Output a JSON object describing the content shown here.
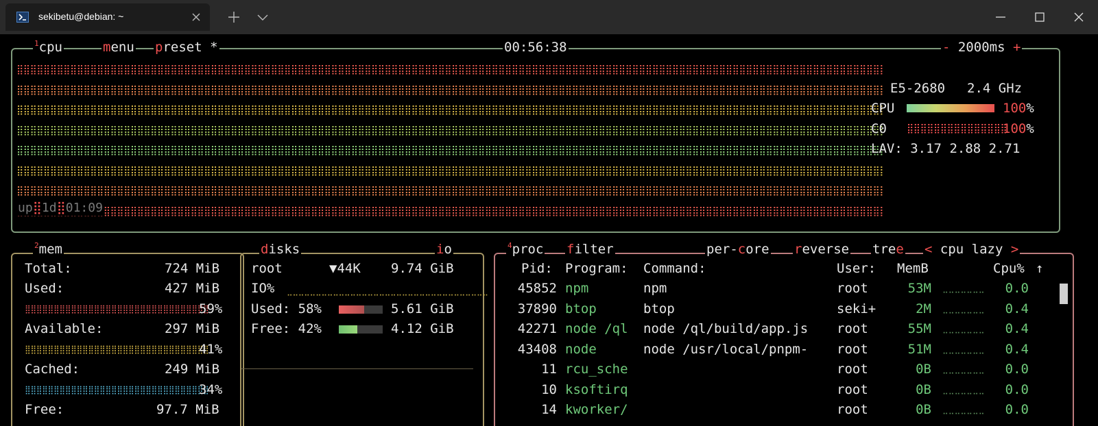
{
  "window": {
    "tab_title": "sekibetu@debian: ~",
    "icons": [
      "terminal-icon",
      "close-icon",
      "plus-icon",
      "chevron-down-icon",
      "minimize-icon",
      "maximize-icon",
      "close-icon"
    ]
  },
  "cpu": {
    "num": "1",
    "label": "cpu",
    "menu_hot": "m",
    "menu_rest": "enu",
    "preset_hot": "p",
    "preset_rest": "reset *",
    "clock": "00:56:38",
    "interval_minus": "-",
    "interval": "2000ms",
    "interval_plus": "+",
    "uptime_label": "up",
    "uptime_days": "1d",
    "uptime_time": "01:09",
    "model": "E5-2680",
    "freq": "2.4 GHz",
    "cpu_label": "CPU",
    "cpu_pct": "100",
    "core_label": "C0",
    "core_pct": "100",
    "pct_sign": "%",
    "lav_label": "LAV:",
    "lav1": "3.17",
    "lav5": "2.88",
    "lav15": "2.71",
    "graph_colors": [
      "#e85a4f",
      "#e8834f",
      "#d8b848",
      "#a8c860",
      "#8fd07a",
      "#d8b848",
      "#e8834f",
      "#e85a4f"
    ]
  },
  "mem": {
    "num": "2",
    "label": "mem",
    "total_label": "Total:",
    "total_value": "724 MiB",
    "used_label": "Used:",
    "used_value": "427 MiB",
    "used_pct": "59%",
    "available_label": "Available:",
    "available_value": "297 MiB",
    "available_pct": "41%",
    "cached_label": "Cached:",
    "cached_value": "249 MiB",
    "cached_pct": "34%",
    "free_label": "Free:",
    "free_value": "97.7 MiB",
    "used_fill": 0.59,
    "available_fill": 0.41,
    "cached_fill": 0.34
  },
  "disks": {
    "label_hot": "d",
    "label_rest": "isks",
    "io_hot": "i",
    "io_rest": "o",
    "root_label": "root",
    "io_rate": "▼44K",
    "root_size": "9.74 GiB",
    "io_pct_label": "IO%",
    "used_label": "Used:",
    "used_pct": "58%",
    "used_size": "5.61 GiB",
    "free_label": "Free:",
    "free_pct": "42%",
    "free_size": "4.12 GiB",
    "used_fill": 0.58,
    "free_fill": 0.42
  },
  "proc": {
    "num": "4",
    "label": "proc",
    "filter_hot": "f",
    "filter_rest": "ilter",
    "percore_a": "per-",
    "percore_hot": "c",
    "percore_b": "ore",
    "reverse_hot": "r",
    "reverse_rest": "everse",
    "tree_a": "tre",
    "tree_hot": "e",
    "sort_left": "<",
    "sort_label": "cpu lazy",
    "sort_right": ">",
    "headers": {
      "pid": "Pid:",
      "program": "Program:",
      "command": "Command:",
      "user": "User:",
      "memb": "MemB",
      "cpu": "Cpu%",
      "sort_arrow": "↑"
    },
    "rows": [
      {
        "pid": "45852",
        "program": "npm",
        "command": "npm",
        "user": "root",
        "mem": "53M",
        "cpu": "0.0"
      },
      {
        "pid": "37890",
        "program": "btop",
        "command": "btop",
        "user": "seki+",
        "mem": "2M",
        "cpu": "0.4"
      },
      {
        "pid": "42271",
        "program": "node /ql",
        "command": "node /ql/build/app.js",
        "user": "root",
        "mem": "55M",
        "cpu": "0.4"
      },
      {
        "pid": "43408",
        "program": "node",
        "command": "node /usr/local/pnpm-",
        "user": "root",
        "mem": "51M",
        "cpu": "0.4"
      },
      {
        "pid": "11",
        "program": "rcu_sche",
        "command": "",
        "user": "root",
        "mem": "0B",
        "cpu": "0.0"
      },
      {
        "pid": "10",
        "program": "ksoftirq",
        "command": "",
        "user": "root",
        "mem": "0B",
        "cpu": "0.0"
      },
      {
        "pid": "14",
        "program": "kworker/",
        "command": "",
        "user": "root",
        "mem": "0B",
        "cpu": "0.0"
      }
    ]
  }
}
